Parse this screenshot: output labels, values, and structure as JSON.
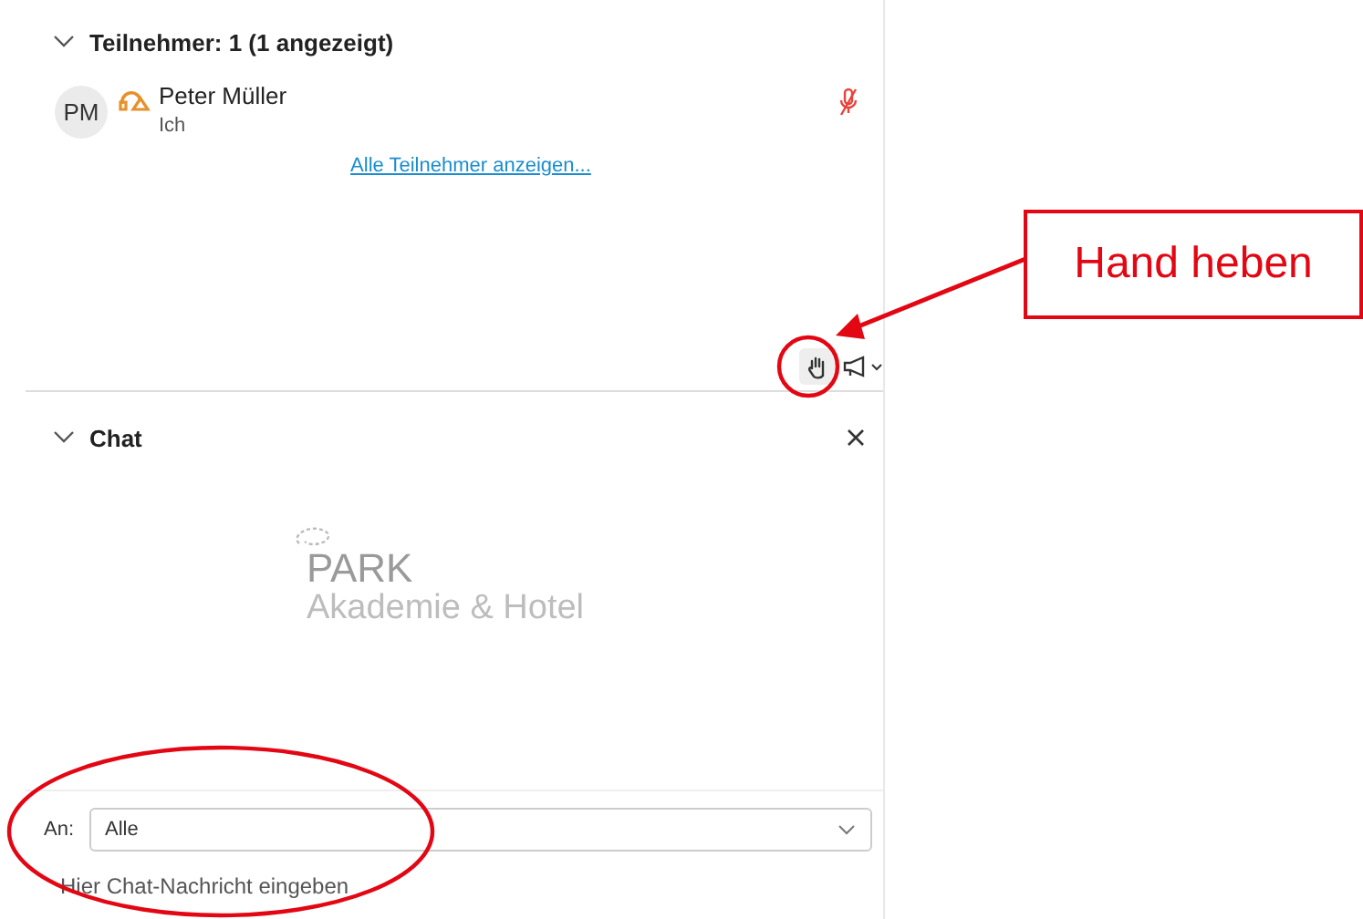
{
  "participants": {
    "title": "Teilnehmer: 1 (1 angezeigt)",
    "expanded": true,
    "list": [
      {
        "initials": "PM",
        "name": "Peter Müller",
        "subtitle": "Ich",
        "muted": true
      }
    ],
    "show_all_link": "Alle Teilnehmer anzeigen..."
  },
  "chat": {
    "title": "Chat",
    "expanded": true,
    "logo": {
      "line1": "PARK",
      "line2": "Akademie & Hotel"
    },
    "recipient_label": "An:",
    "recipient_value": "Alle",
    "message_placeholder": "Hier Chat-Nachricht eingeben"
  },
  "callout": {
    "text": "Hand heben"
  }
}
